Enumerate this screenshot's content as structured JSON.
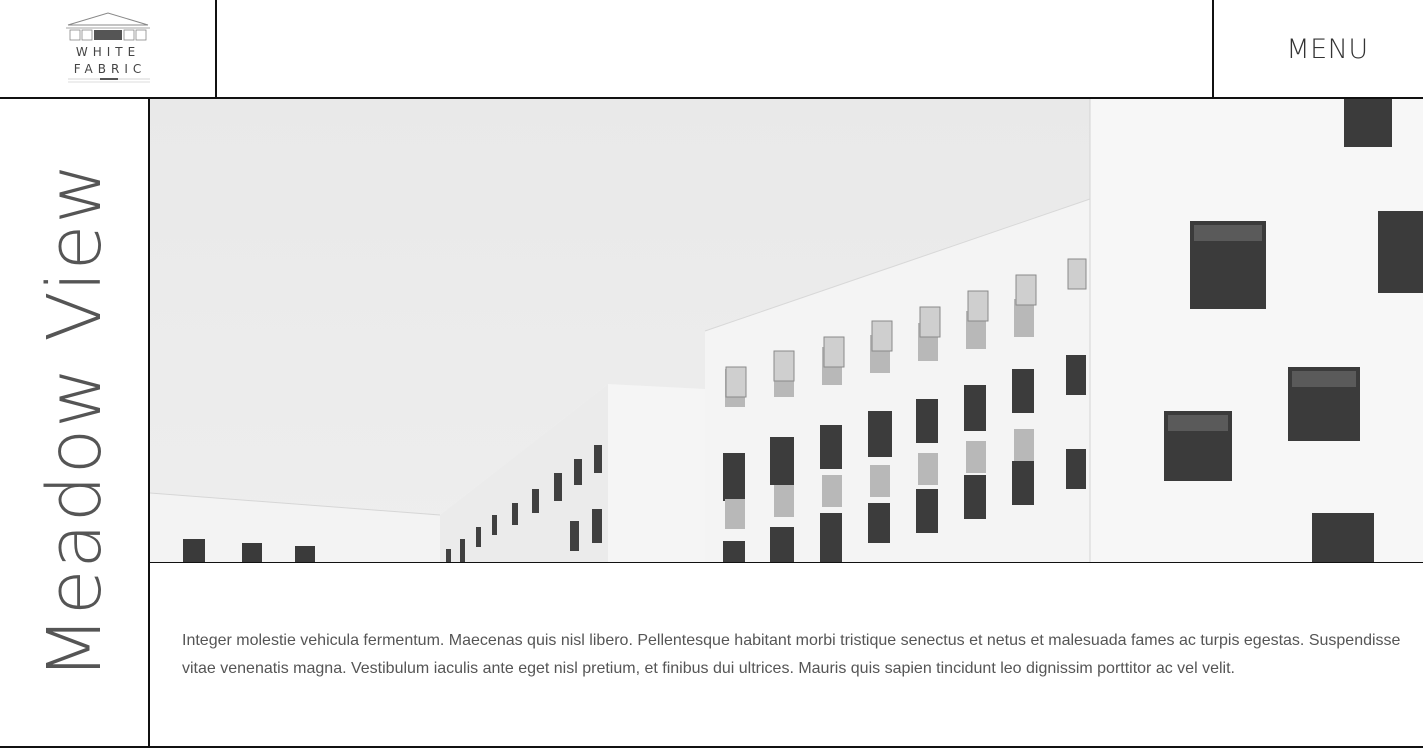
{
  "header": {
    "logo_line1": "WHITE",
    "logo_line2": "FABRIC",
    "menu_label": "MENU"
  },
  "sidebar": {
    "vertical_title": "Meadow View"
  },
  "hero": {
    "image_subject": "white modernist buildings with square windows against a pale sky"
  },
  "content": {
    "description": "Integer molestie vehicula fermentum. Maecenas quis nisl libero. Pellentesque habitant morbi tristique senectus et netus et malesuada fames ac turpis egestas. Suspendisse vitae venenatis magna. Vestibulum iaculis ante eget nisl pretium, et finibus dui ultrices. Mauris quis sapien tincidunt leo dignissim porttitor ac vel velit."
  },
  "colors": {
    "border": "#111111",
    "text": "#555555",
    "sky": "#ececec"
  }
}
